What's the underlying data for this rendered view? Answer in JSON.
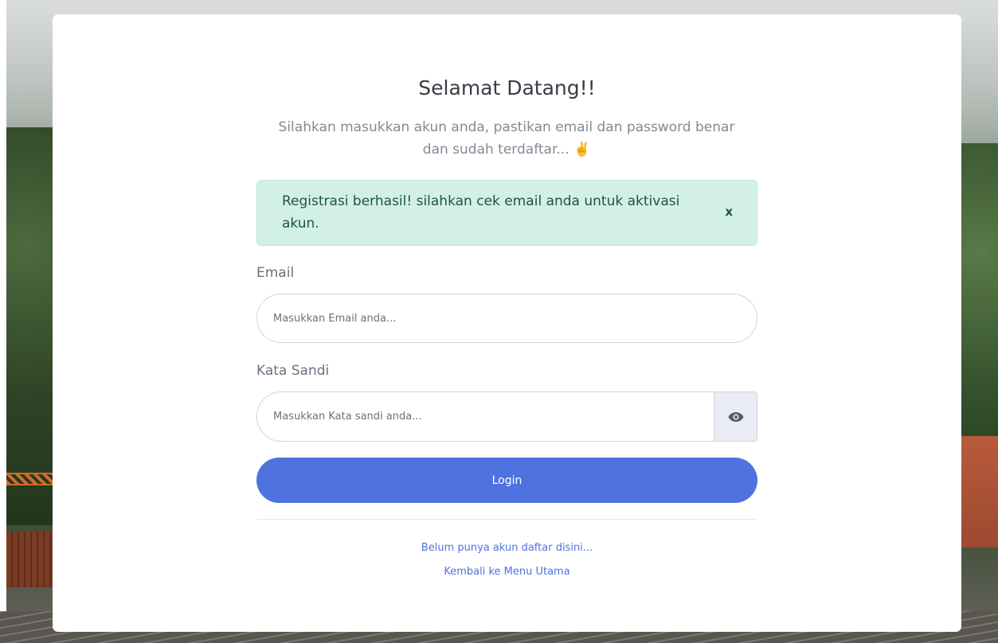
{
  "page": {
    "title": "Selamat Datang!!",
    "subtitle_line1": "Silahkan masukkan akun anda, pastikan email dan password benar",
    "subtitle_line2": "dan sudah terdaftar... ✌️"
  },
  "alert": {
    "message": "Registrasi berhasil! silahkan cek email anda untuk aktivasi akun.",
    "close_label": "x",
    "color": "#d2f1e4"
  },
  "form": {
    "email_label": "Email",
    "email_placeholder": "Masukkan Email anda...",
    "email_value": "",
    "password_label": "Kata Sandi",
    "password_placeholder": "Masukkan Kata sandi anda...",
    "password_value": "",
    "toggle_icon": "eye-icon",
    "login_label": "Login",
    "accent_color": "#4e73df"
  },
  "links": {
    "register": "Belum punya akun daftar disini...",
    "home": "Kembali ke Menu Utama"
  }
}
